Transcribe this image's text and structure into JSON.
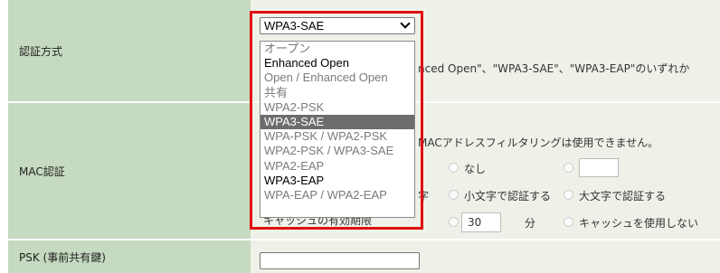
{
  "rows": {
    "auth_label": "認証方式",
    "mac_label": "MAC認証",
    "psk_label": "PSK (事前共有鍵)"
  },
  "auth": {
    "selected": "WPA3-SAE",
    "note": "nced Open\"、\"WPA3-SAE\"、\"WPA3-EAP\"のいずれか",
    "options": [
      {
        "label": "オープン",
        "style": "gray"
      },
      {
        "label": "Enhanced Open",
        "style": "black"
      },
      {
        "label": "Open / Enhanced Open",
        "style": "gray"
      },
      {
        "label": "共有",
        "style": "gray"
      },
      {
        "label": "WPA2-PSK",
        "style": "gray"
      },
      {
        "label": "WPA3-SAE",
        "style": "sel"
      },
      {
        "label": "WPA-PSK / WPA2-PSK",
        "style": "gray"
      },
      {
        "label": "WPA2-PSK / WPA3-SAE",
        "style": "gray"
      },
      {
        "label": "WPA2-EAP",
        "style": "gray"
      },
      {
        "label": "WPA3-EAP",
        "style": "black"
      },
      {
        "label": "WPA-EAP / WPA2-EAP",
        "style": "gray"
      }
    ]
  },
  "mac": {
    "note": "MACアドレスフィルタリングは使用できません。",
    "opt_none": "なし",
    "opt_lower": "小文字で認証する",
    "opt_upper": "大文字で認証する",
    "lower_row_prefix": "字",
    "cache_label": "キャッシュの有効期限",
    "cache_value": "30",
    "cache_unit": "分",
    "opt_no_cache": "キャッシュを使用しない"
  },
  "psk": {
    "value": ""
  },
  "colors": {
    "label_bg": "#c5dac0",
    "value_bg": "#eef1e8",
    "highlight_border": "#e01010",
    "selected_option_bg": "#6d6d6d"
  }
}
